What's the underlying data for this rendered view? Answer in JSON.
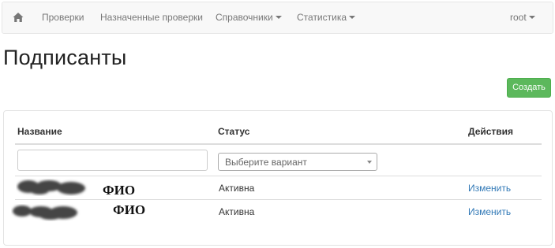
{
  "navbar": {
    "home_icon": "home-icon",
    "items": [
      {
        "label": "Проверки"
      },
      {
        "label": "Назначенные проверки"
      },
      {
        "label": "Справочники"
      },
      {
        "label": "Статистика"
      }
    ],
    "user": "root"
  },
  "page": {
    "title": "Подписанты",
    "create_button": "Создать"
  },
  "table": {
    "headers": [
      "Название",
      "Статус",
      "Действия"
    ],
    "filter": {
      "name_placeholder": "",
      "status_placeholder": "Выберите вариант"
    },
    "rows": [
      {
        "name": "ФИО",
        "status": "Активна",
        "action": "Изменить"
      },
      {
        "name": "ФИО",
        "status": "Активна",
        "action": "Изменить"
      }
    ]
  },
  "colors": {
    "primary_button": "#5cb85c",
    "link": "#337ab7",
    "navbar_bg": "#f8f8f8"
  }
}
